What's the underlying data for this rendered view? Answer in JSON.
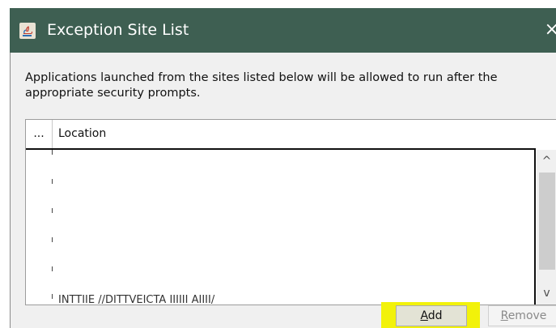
{
  "window": {
    "title": "Exception Site List",
    "icon": "java-icon",
    "close_glyph": "×"
  },
  "dialog": {
    "description": "Applications launched from the sites listed below will be allowed to run after the appropriate security prompts."
  },
  "table": {
    "columns": [
      "...",
      "Location"
    ],
    "partial_row_text": "INTTIIE //DITTVEICTA IIIIII AIIII/"
  },
  "scrollbar": {
    "up_glyph": "^",
    "down_glyph": "v"
  },
  "buttons": {
    "add": {
      "mnemonic": "A",
      "rest": "dd"
    },
    "remove": {
      "mnemonic": "R",
      "rest": "emove"
    }
  },
  "colors": {
    "titlebar": "#3e5f52",
    "add_highlight": "#f2f20a"
  }
}
